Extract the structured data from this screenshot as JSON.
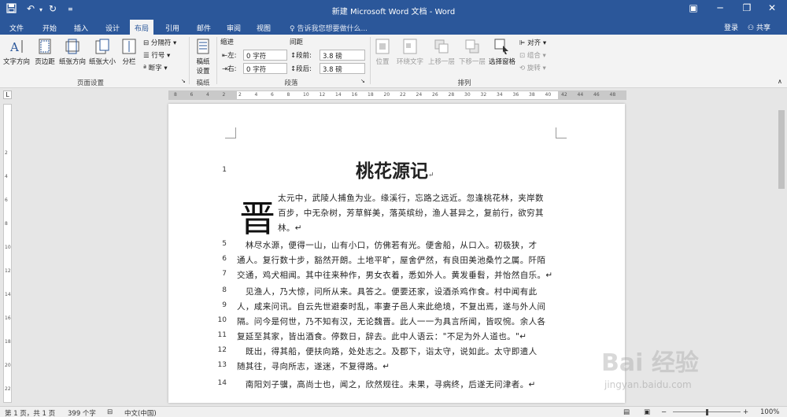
{
  "titlebar": {
    "title": "新建 Microsoft Word 文档 - Word",
    "save_icon": "save-icon",
    "undo_icon": "undo-icon",
    "redo_icon": "redo-icon"
  },
  "tabs": [
    {
      "label": "文件"
    },
    {
      "label": "开始"
    },
    {
      "label": "插入"
    },
    {
      "label": "设计"
    },
    {
      "label": "布局"
    },
    {
      "label": "引用"
    },
    {
      "label": "邮件"
    },
    {
      "label": "审阅"
    },
    {
      "label": "视图"
    }
  ],
  "tellme": "♀ 告诉我您想要做什么...",
  "signin": "登录",
  "share": "共享",
  "ribbon": {
    "page_setup": {
      "text_direction": "文字方向",
      "margins": "页边距",
      "orientation": "纸张方向",
      "size": "纸张大小",
      "columns": "分栏",
      "breaks": "分隔符",
      "line_numbers": "行号",
      "hyphenation": "断字",
      "group_label": "页面设置"
    },
    "draft": {
      "label": "稿纸设置",
      "group_label": "稿纸"
    },
    "paragraph": {
      "indent_header": "缩进",
      "spacing_header": "间距",
      "left_label": "左:",
      "left_value": "0 字符",
      "right_label": "右:",
      "right_value": "0 字符",
      "before_label": "段前:",
      "before_value": "3.8 磅",
      "after_label": "段后:",
      "after_value": "3.8 磅",
      "group_label": "段落"
    },
    "arrange": {
      "position": "位置",
      "wrap": "环绕文字",
      "forward": "上移一层",
      "backward": "下移一层",
      "selection_pane": "选择窗格",
      "align": "对齐",
      "group": "组合",
      "rotate": "旋转",
      "group_label": "排列"
    }
  },
  "ruler": {
    "ticks": [
      "8",
      "6",
      "4",
      "2",
      "2",
      "4",
      "6",
      "8",
      "10",
      "12",
      "14",
      "16",
      "18",
      "20",
      "22",
      "24",
      "26",
      "28",
      "30",
      "32",
      "34",
      "36",
      "38",
      "40",
      "42",
      "44",
      "46",
      "48"
    ]
  },
  "vruler_ticks": [
    "2",
    "4",
    "6",
    "8",
    "10",
    "12",
    "14",
    "16",
    "18",
    "20",
    "22"
  ],
  "document": {
    "title": "桃花源记",
    "dropcap": "晋",
    "lines": [
      {
        "num": "1",
        "text": ""
      },
      {
        "num": "",
        "text": "太元中，武陵人捕鱼为业。缘溪行，忘路之远近。忽逢桃花林，夹岸数"
      },
      {
        "num": "",
        "text": "百步，中无杂树，芳草鲜美，落英缤纷，渔人甚异之，复前行，欲穷其"
      },
      {
        "num": "",
        "text": "林。↵"
      },
      {
        "num": "5",
        "text": "　林尽水源，便得一山，山有小口，仿佛若有光。便舍船，从口入。初极狭，才"
      },
      {
        "num": "6",
        "text": "通人。复行数十步，豁然开朗。土地平旷，屋舍俨然，有良田美池桑竹之属。阡陌"
      },
      {
        "num": "7",
        "text": "交通，鸡犬相闻。其中往来种作，男女衣着，悉如外人。黄发垂髫，并怡然自乐。↵"
      },
      {
        "num": "8",
        "text": "　见渔人，乃大惊，问所从来。具答之。便要还家，设酒杀鸡作食。村中闻有此"
      },
      {
        "num": "9",
        "text": "人，咸来问讯。自云先世避秦时乱，率妻子邑人来此绝境，不复出焉，遂与外人间"
      },
      {
        "num": "10",
        "text": "隔。问今是何世，乃不知有汉，无论魏晋。此人一一为具言所闻，皆叹惋。余人各"
      },
      {
        "num": "11",
        "text": "复延至其家，皆出酒食。停数日，辞去。此中人语云：\"不足为外人道也。\"↵"
      },
      {
        "num": "12",
        "text": "　既出，得其船，便扶向路，处处志之。及郡下，诣太守，说如此。太守即遣人"
      },
      {
        "num": "13",
        "text": "随其往，寻向所志，遂迷，不复得路。↵"
      },
      {
        "num": "14",
        "text": "　南阳刘子骥，高尚士也，闻之，欣然规往。未果，寻病终，后遂无问津者。↵"
      }
    ]
  },
  "statusbar": {
    "page": "第 1 页，共 1 页",
    "words": "399 个字",
    "lang": "中文(中国)",
    "zoom": "100%",
    "zoom_fraction": 0.5
  },
  "watermark": {
    "main": "Bai 经验",
    "sub": "jingyan.baidu.com"
  },
  "colors": {
    "accent": "#2b579a",
    "ribbon_bg": "#f3f3f3",
    "page_bg": "#ffffff"
  }
}
